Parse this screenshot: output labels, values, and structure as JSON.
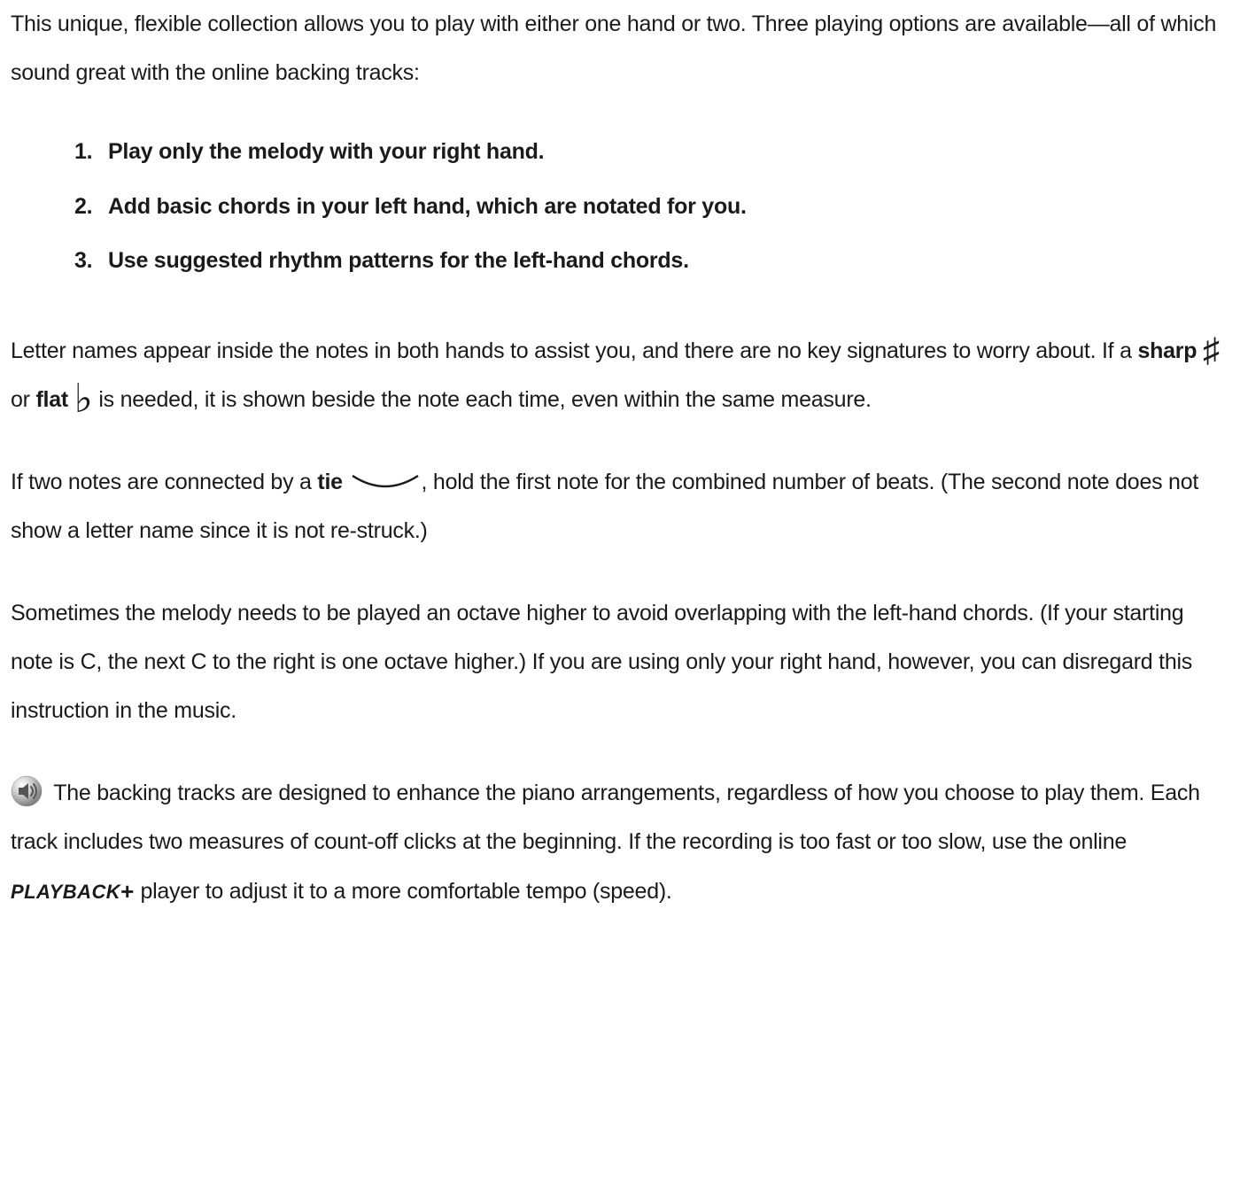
{
  "intro": "This unique, flexible collection allows you to play with either one hand or two. Three playing options are available—all of which sound great with the online backing tracks:",
  "options": [
    "Play only the melody with your right hand.",
    "Add basic chords in your left hand, which are notated for you.",
    "Use suggested rhythm patterns for the left-hand chords."
  ],
  "letterNames": {
    "pre": "Letter names appear inside the notes in both hands to assist you, and there are no key signatures to worry about. If a ",
    "sharp": "sharp",
    "sharpSymbol": "♯",
    "or": " or ",
    "flat": "flat",
    "flatSymbol": "♭",
    "post": " is needed, it is shown beside the note each time, even within the same measure."
  },
  "tie": {
    "pre": "If two notes are connected by a ",
    "label": "tie",
    "post": ", hold the first note for the combined number of beats. (The second note does not show a letter name since it is not re-struck.)"
  },
  "octave": "Sometimes the melody needs to be played an octave higher to avoid overlapping with the left-hand chords. (If your starting note is C, the next C to the right is one octave higher.) If you are using only your right hand, however, you can disregard this instruction in the music.",
  "backing": {
    "pre": " The backing tracks are designed to enhance the piano arrangements, regardless of how you choose to play them. Each track includes two measures of count-off clicks at the beginning. If the recording is too fast or too slow, use the online ",
    "brand": "PLAYBACK",
    "plus": "+",
    "post": " player to adjust it to a more comfortable tempo (speed)."
  }
}
